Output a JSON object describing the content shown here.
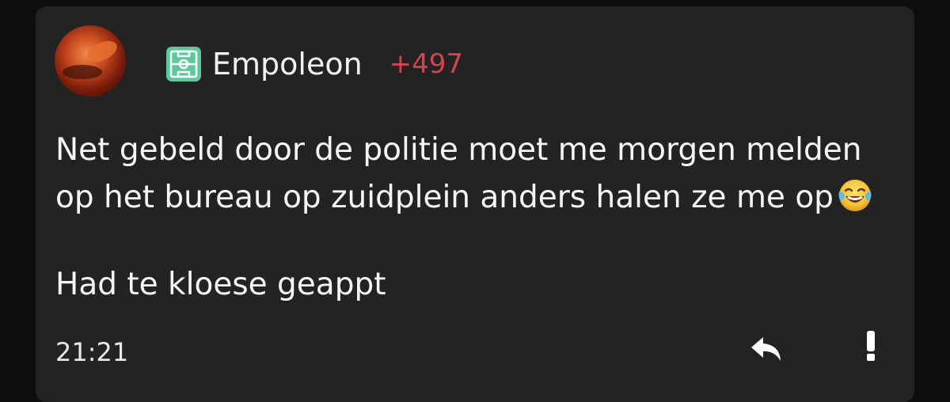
{
  "comment": {
    "author": "Empoleon",
    "karma": "+497",
    "team_icon": "soccer-field-icon",
    "avatar_icon": "avatar",
    "body_lines": [
      "Net gebeld door de politie moet me morgen melden op het bureau op zuidplein anders halen ze me op",
      "Had te kloese geappt"
    ],
    "emoji": "face-with-tears-of-joy",
    "time": "21:21",
    "actions": {
      "reply_icon": "reply-icon",
      "report_icon": "exclamation-icon"
    }
  },
  "colors": {
    "background": "#0e0e0e",
    "card": "#232323",
    "karma": "#d8434b",
    "team_icon": "#5cc99a"
  }
}
